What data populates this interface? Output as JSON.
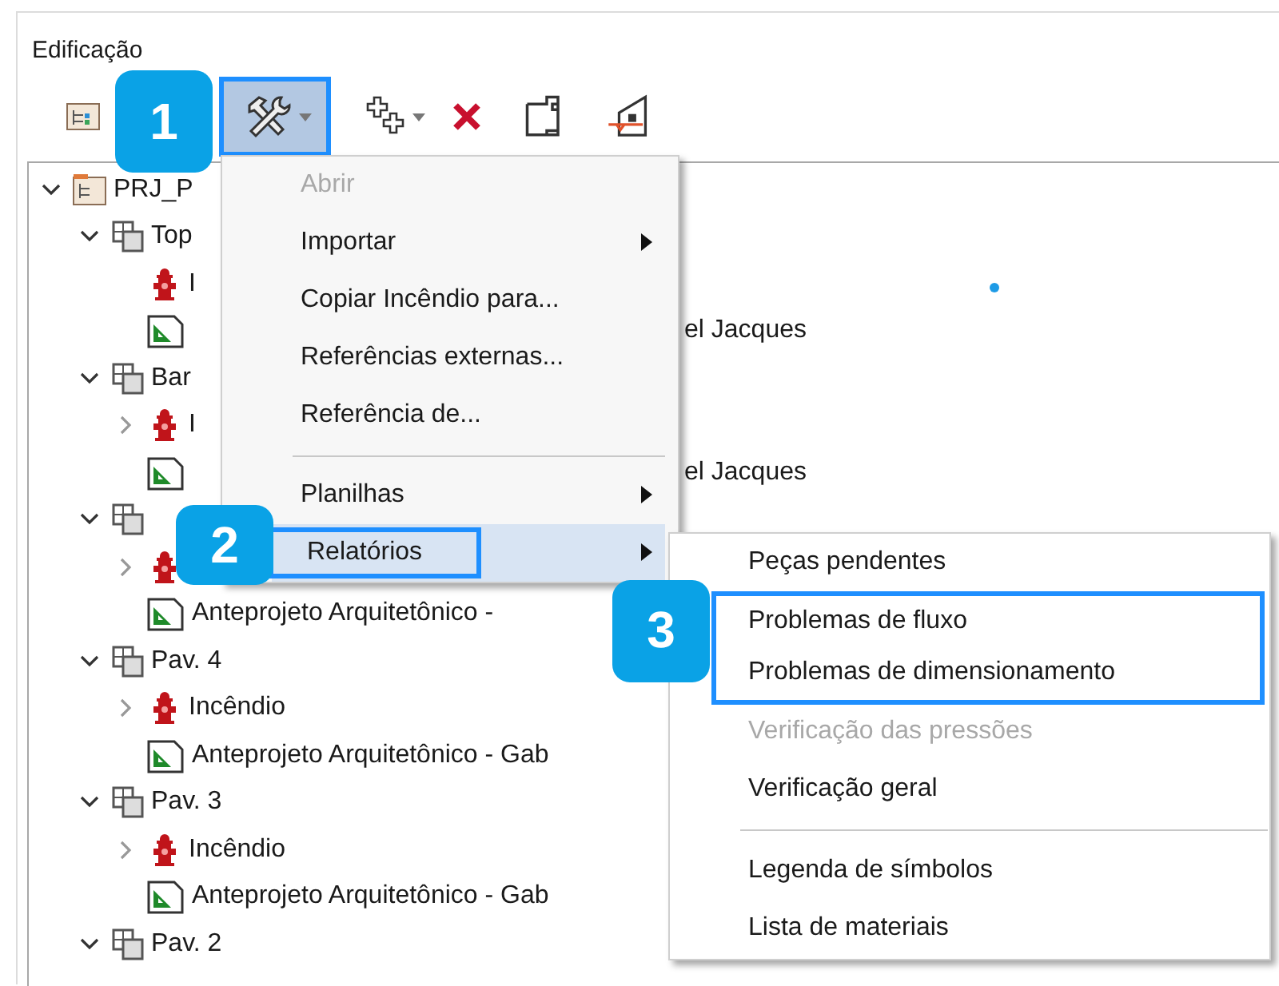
{
  "panel": {
    "title": "Edificação"
  },
  "toolbar": [
    {
      "kind": "tree",
      "selected": false,
      "highlighted": false,
      "dropdown": false
    },
    {
      "kind": "tools",
      "selected": true,
      "highlighted": true,
      "dropdown": true,
      "callout": "1"
    },
    {
      "kind": "add",
      "selected": false,
      "highlighted": false,
      "dropdown": true
    },
    {
      "kind": "delete",
      "selected": false,
      "highlighted": false,
      "dropdown": false
    },
    {
      "kind": "newpage",
      "selected": false,
      "highlighted": false,
      "dropdown": false
    },
    {
      "kind": "building",
      "selected": false,
      "highlighted": false,
      "dropdown": false
    }
  ],
  "tree": [
    {
      "kind": "project",
      "label": "PRJ_P",
      "expanded": true,
      "children": [
        {
          "kind": "floor",
          "label": "Top",
          "expanded": true,
          "children": [
            {
              "kind": "fire",
              "label": "I"
            },
            {
              "kind": "drawing",
              "tail": "el Jacques"
            }
          ]
        },
        {
          "kind": "floor",
          "label": "Bar",
          "expanded": true,
          "children": [
            {
              "kind": "fire",
              "label": "I",
              "expanded": false
            },
            {
              "kind": "drawing",
              "tail": "el Jacques"
            }
          ]
        },
        {
          "kind": "floor",
          "expanded": true,
          "children": [
            {
              "kind": "fire",
              "expanded": false
            },
            {
              "kind": "drawing",
              "label": "Anteprojeto Arquitetônico -"
            }
          ]
        },
        {
          "kind": "floor",
          "label": "Pav. 4",
          "expanded": true,
          "children": [
            {
              "kind": "fire",
              "label": "Incêndio",
              "expanded": false
            },
            {
              "kind": "drawing",
              "label": "Anteprojeto Arquitetônico - Gab"
            }
          ]
        },
        {
          "kind": "floor",
          "label": "Pav. 3",
          "expanded": true,
          "children": [
            {
              "kind": "fire",
              "label": "Incêndio",
              "expanded": false
            },
            {
              "kind": "drawing",
              "label": "Anteprojeto Arquitetônico - Gab"
            }
          ]
        },
        {
          "kind": "floor",
          "label": "Pav. 2",
          "expanded": true
        }
      ]
    }
  ],
  "menu": {
    "items": [
      {
        "kind": "item",
        "label": "Abrir",
        "disabled": true,
        "submenu": false,
        "selected": false
      },
      {
        "kind": "item",
        "label": "Importar",
        "disabled": false,
        "submenu": true,
        "selected": false
      },
      {
        "kind": "item",
        "label": "Copiar Incêndio para...",
        "disabled": false,
        "submenu": false,
        "selected": false
      },
      {
        "kind": "item",
        "label": "Referências externas...",
        "disabled": false,
        "submenu": false,
        "selected": false
      },
      {
        "kind": "item",
        "label": "Referência de...",
        "disabled": false,
        "submenu": false,
        "selected": false
      },
      {
        "kind": "separator"
      },
      {
        "kind": "item",
        "label": "Planilhas",
        "disabled": false,
        "submenu": true,
        "selected": false
      },
      {
        "kind": "item",
        "label": "Relatórios",
        "disabled": false,
        "submenu": true,
        "selected": true,
        "highlighted": true,
        "callout": "2"
      }
    ]
  },
  "submenu": {
    "items": [
      {
        "kind": "item",
        "label": "Peças pendentes",
        "disabled": false,
        "highlighted": false
      },
      {
        "kind": "item",
        "label": "Problemas de fluxo",
        "disabled": false,
        "highlighted": true,
        "callout": "3"
      },
      {
        "kind": "item",
        "label": "Problemas de dimensionamento",
        "disabled": false,
        "highlighted": true
      },
      {
        "kind": "item",
        "label": "Verificação das pressões",
        "disabled": true,
        "highlighted": false
      },
      {
        "kind": "item",
        "label": "Verificação geral",
        "disabled": false,
        "highlighted": false
      },
      {
        "kind": "separator"
      },
      {
        "kind": "item",
        "label": "Legenda de símbolos",
        "disabled": false,
        "highlighted": false
      },
      {
        "kind": "item",
        "label": "Lista de materiais",
        "disabled": false,
        "highlighted": false
      }
    ]
  }
}
